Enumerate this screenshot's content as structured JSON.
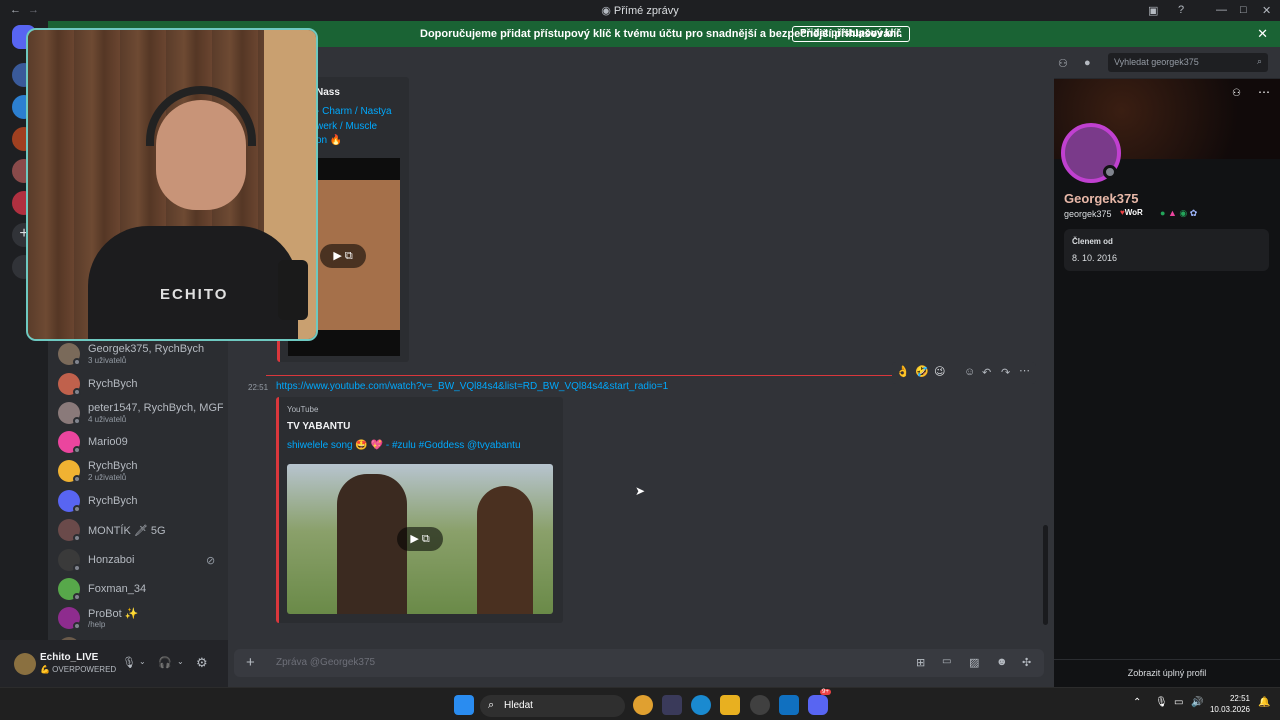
{
  "titlebar": {
    "title": "Přímé zprávy"
  },
  "banner": {
    "message": "Doporučujeme přidat přístupový klíč k tvému účtu pro snadnější a bezpečnější přihlašování.",
    "button": "Přidat přístupový klíč",
    "close": "✕"
  },
  "header": {
    "search_placeholder": "Vyhledat georgek375"
  },
  "messages": {
    "top_embed": {
      "author": "Nass",
      "line1": "- Charm / Nastya",
      "line2": "werk  / Muscle",
      "line3": "on 🔥"
    },
    "msg2": {
      "time": "22:51",
      "url": "https://www.youtube.com/watch?v=_BW_VQl84s4&list=RD_BW_VQl84s4&start_radio=1",
      "provider": "YouTube",
      "channel": "TV YABANTU",
      "video_title": "shiwelele song 🤩 💖 - #zulu #Goddess @tvyabantu"
    },
    "reactions": [
      "👌",
      "🤣",
      "😉"
    ]
  },
  "dm_list": [
    {
      "name": "Georgek375, RychBych",
      "sub": "3 uživatelů",
      "color": "#7a6a5a"
    },
    {
      "name": "RychBych",
      "sub": "",
      "color": "#c0614c"
    },
    {
      "name": "peter1547, RychBych, MGF...",
      "sub": "4 uživatelů",
      "color": "#8a7a7a"
    },
    {
      "name": "Mario09",
      "sub": "",
      "color": "#eb459e"
    },
    {
      "name": "RychBych",
      "sub": "2 uživatelů",
      "color": "#f0b232"
    },
    {
      "name": "RychBych",
      "sub": "",
      "color": "#5865f2"
    },
    {
      "name": "MONTÍK 🗡 5G",
      "sub": "",
      "color": "#6a4a4a"
    },
    {
      "name": "Honzaboi",
      "sub": "",
      "color": "#3a3a3a"
    },
    {
      "name": "Foxman_34",
      "sub": "",
      "color": "#57a84a"
    },
    {
      "name": "ProBot ✨",
      "sub": "/help",
      "color": "#8e2c8e"
    },
    {
      "name": "Lord_game, RychBych",
      "sub": "",
      "color": "#6a5a4a"
    }
  ],
  "user_panel": {
    "name": "Echito_LIVE",
    "status": "💪 OVERPOWERED"
  },
  "composer": {
    "placeholder": "Zpráva @Georgek375"
  },
  "profile": {
    "display_name": "Georgek375",
    "username": "georgek375",
    "tag": "WoR",
    "member_since_label": "Členem od",
    "member_since": "8. 10. 2016",
    "full_profile": "Zobrazit úplný profil"
  },
  "taskbar": {
    "search": "Hledat",
    "time": "22:51",
    "date": "10.03.2026",
    "badge": "9+"
  },
  "webcam": {
    "shirt_text": "ECHITO"
  }
}
